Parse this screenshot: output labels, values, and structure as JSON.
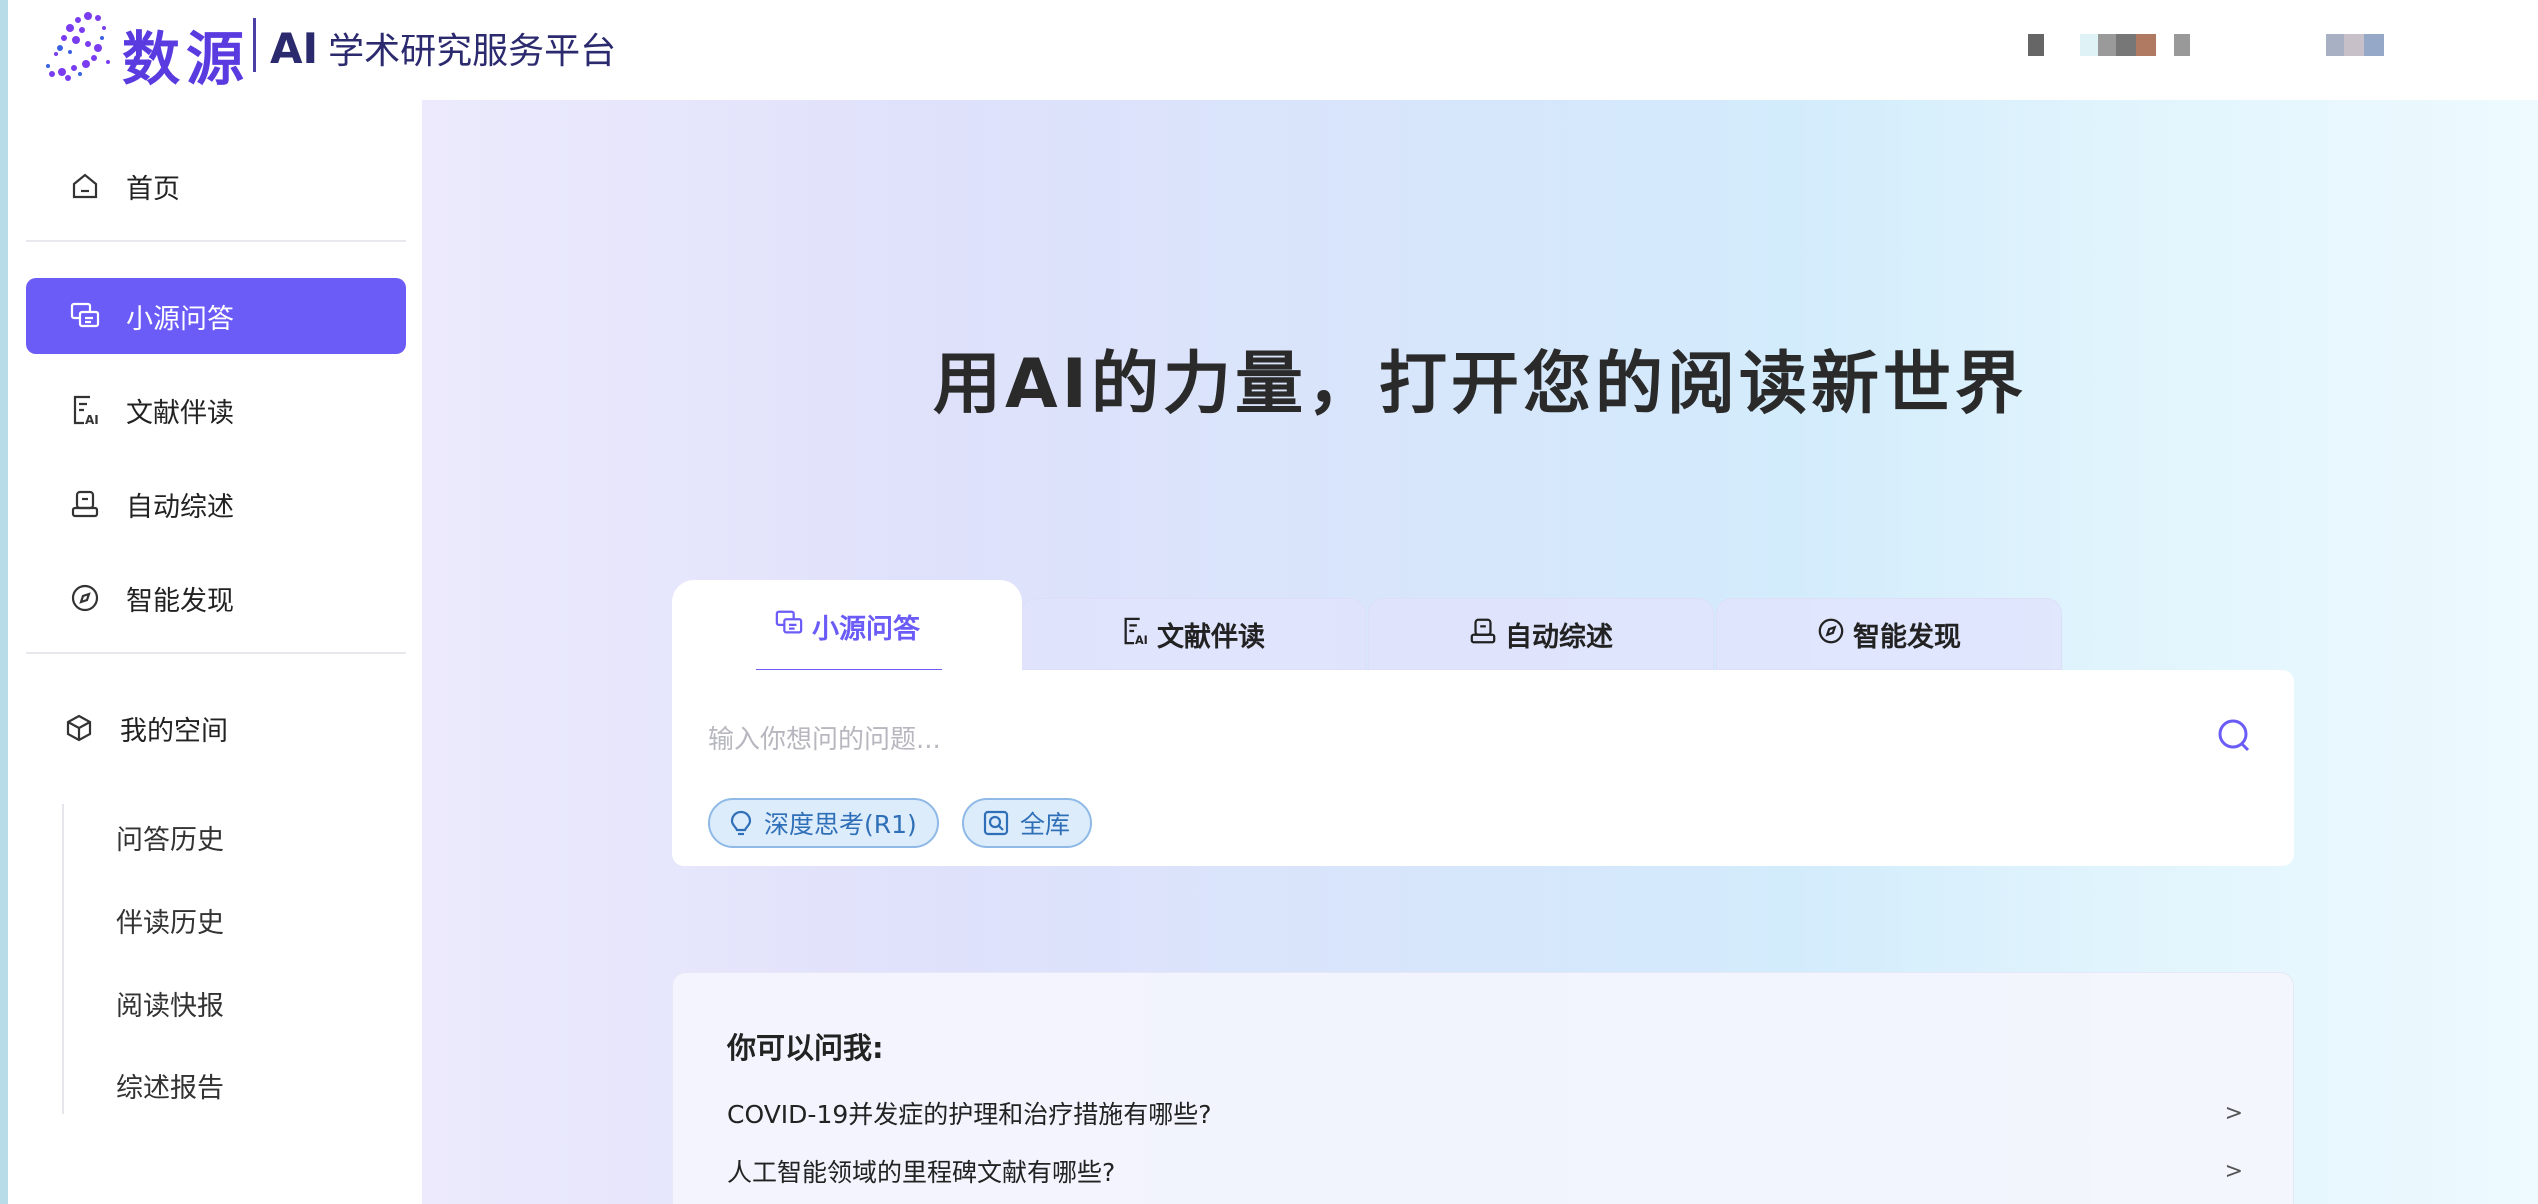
{
  "header": {
    "brand_name": "数源",
    "brand_ai": "AI",
    "brand_sub": "学术研究服务平台"
  },
  "sidebar": {
    "items": [
      {
        "label": "首页",
        "icon": "home-icon",
        "active": false
      },
      {
        "label": "小源问答",
        "icon": "chat-icon",
        "active": true
      },
      {
        "label": "文献伴读",
        "icon": "document-ai-icon",
        "active": false
      },
      {
        "label": "自动综述",
        "icon": "review-icon",
        "active": false
      },
      {
        "label": "智能发现",
        "icon": "compass-icon",
        "active": false
      }
    ],
    "space": {
      "label": "我的空间",
      "icon": "cube-icon"
    },
    "sub_items": [
      "问答历史",
      "伴读历史",
      "阅读快报",
      "综述报告"
    ]
  },
  "main": {
    "headline": "用AI的力量，打开您的阅读新世界",
    "tabs": [
      {
        "label": "小源问答",
        "icon": "chat-icon",
        "active": true
      },
      {
        "label": "文献伴读",
        "icon": "document-ai-icon",
        "active": false
      },
      {
        "label": "自动综述",
        "icon": "review-icon",
        "active": false
      },
      {
        "label": "智能发现",
        "icon": "compass-icon",
        "active": false
      }
    ],
    "search": {
      "placeholder": "输入你想问的问题...",
      "value": ""
    },
    "chips": [
      {
        "label": "深度思考(R1)",
        "icon": "lightbulb-icon"
      },
      {
        "label": "全库",
        "icon": "library-search-icon"
      }
    ],
    "suggestions": {
      "title": "你可以问我:",
      "items": [
        {
          "text": "COVID-19并发症的护理和治疗措施有哪些?",
          "arrow": ">"
        },
        {
          "text": "人工智能领域的里程碑文献有哪些?",
          "arrow": ">"
        }
      ]
    }
  },
  "colors": {
    "accent": "#6b5cf7",
    "chip_bg": "#dcecfb",
    "chip_text": "#2f6fb8"
  }
}
